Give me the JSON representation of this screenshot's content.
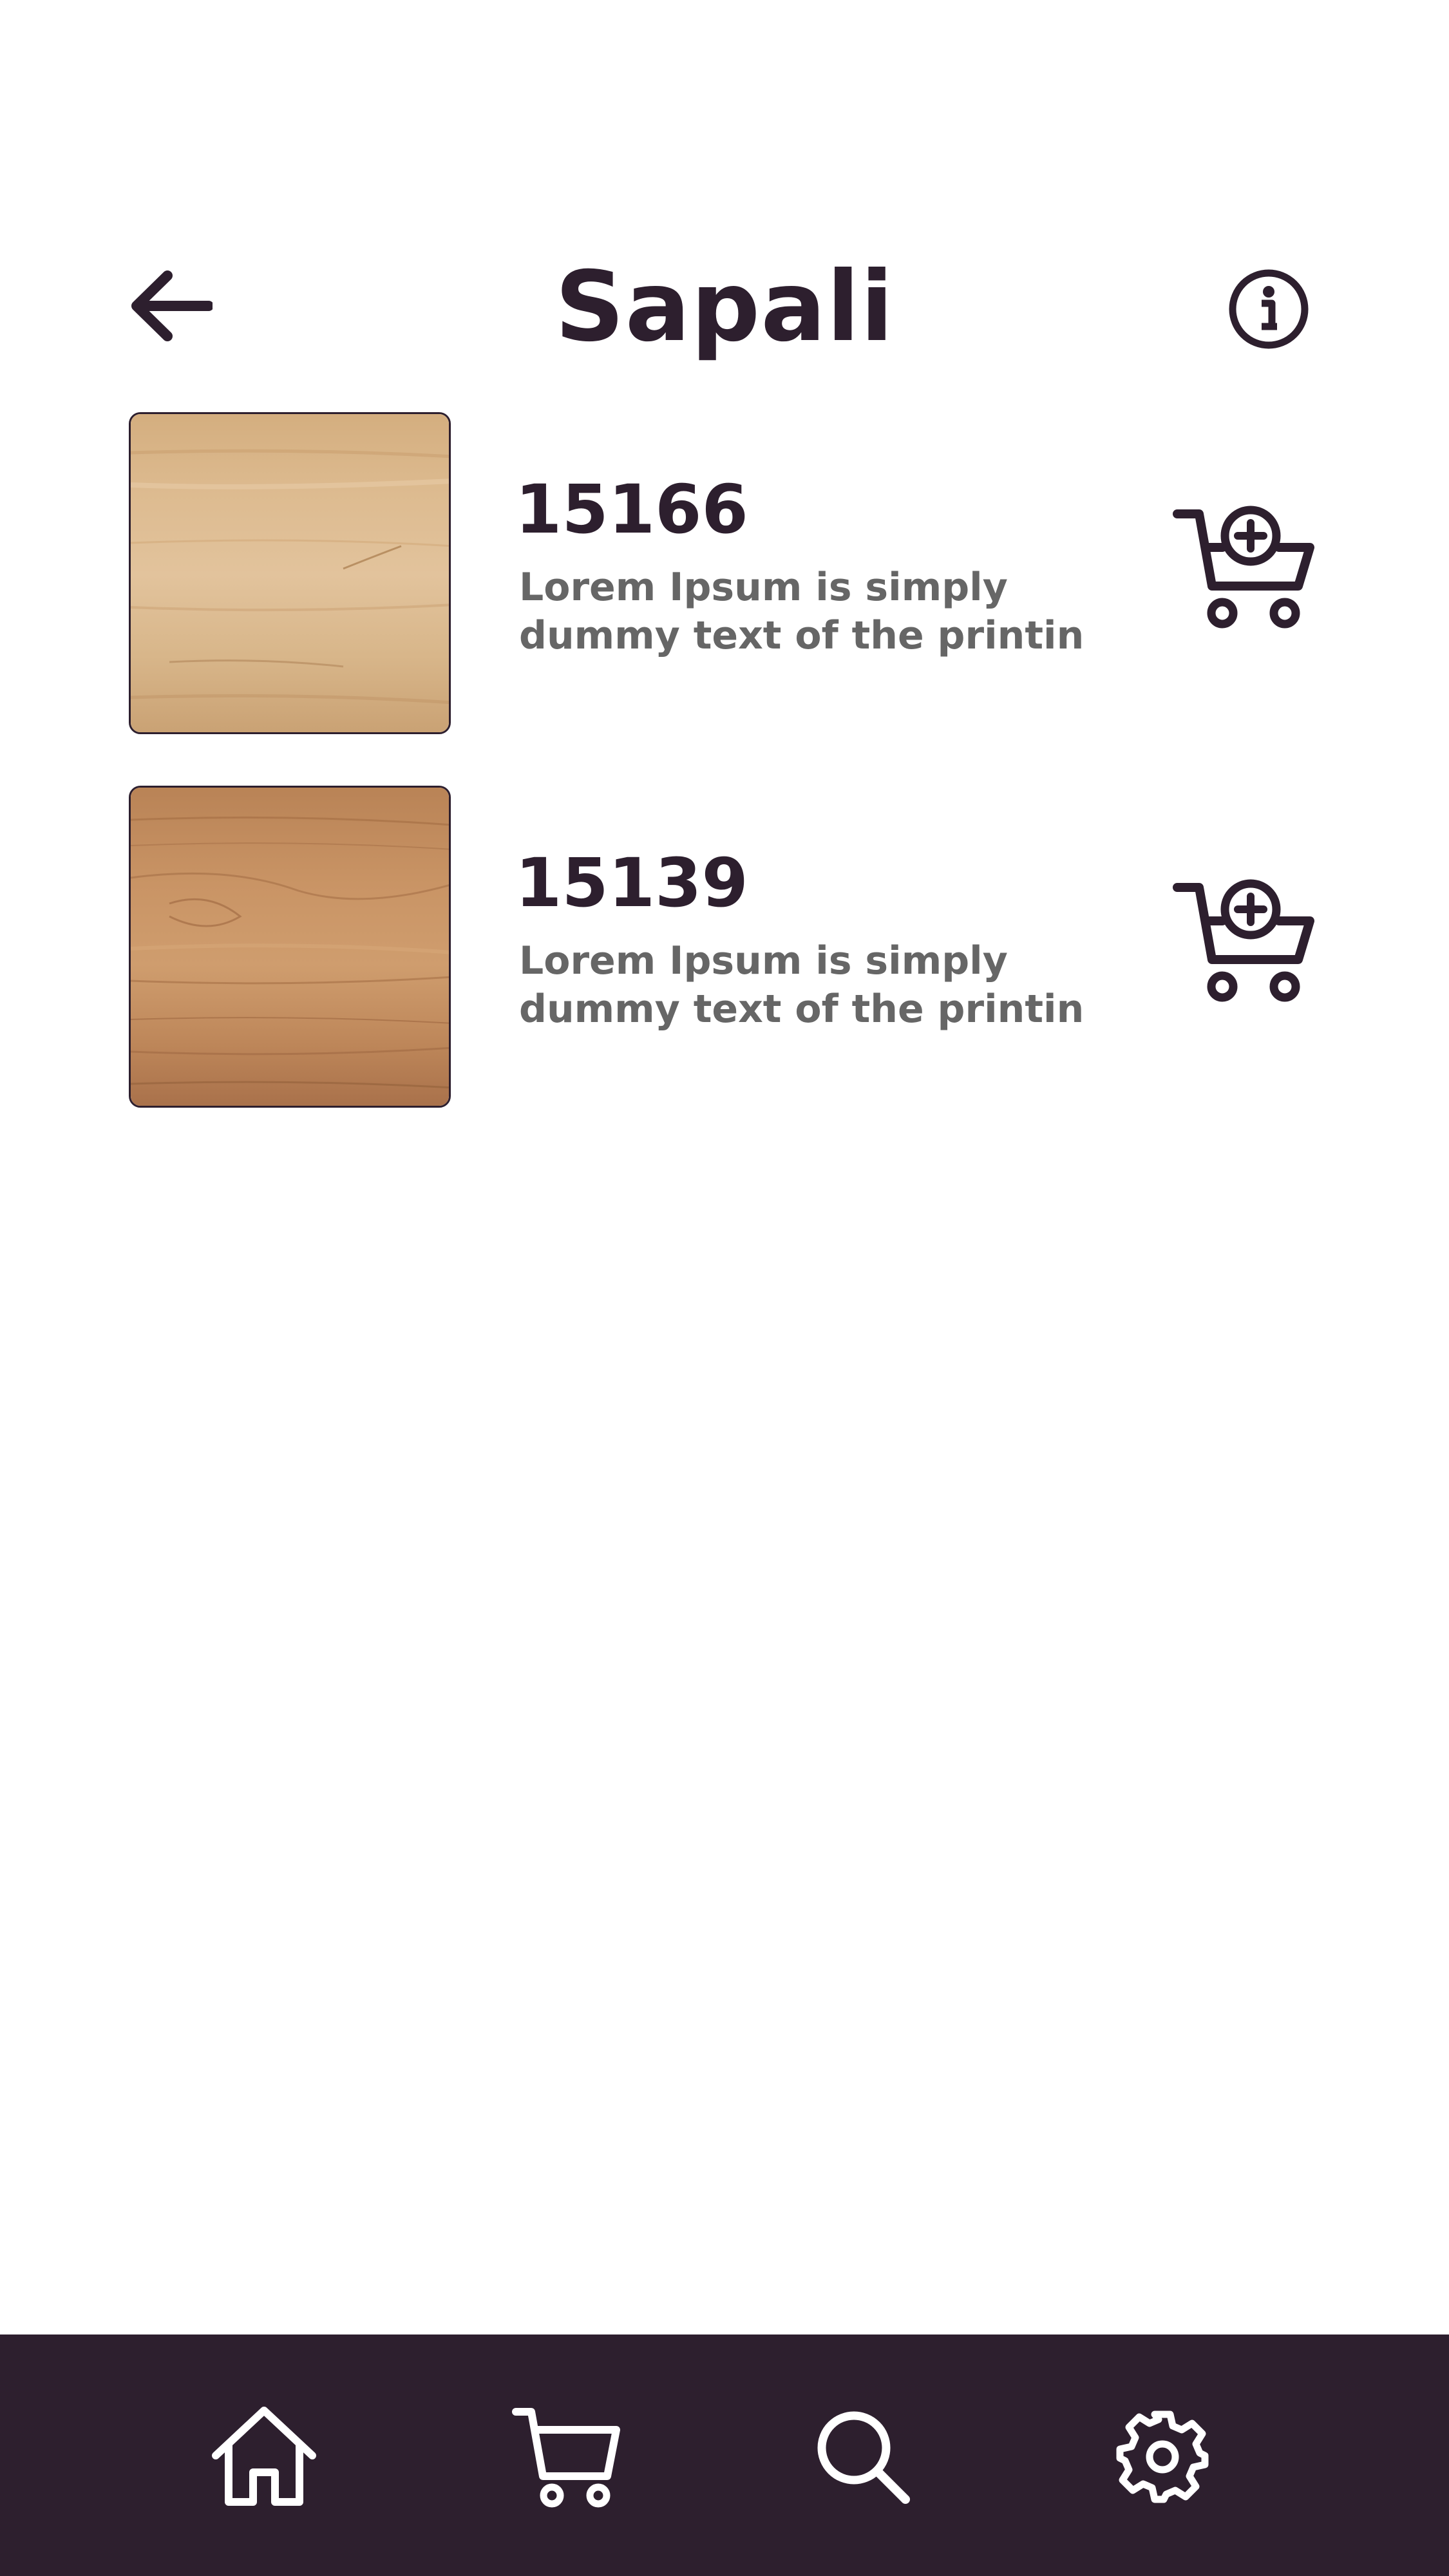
{
  "header": {
    "title": "Sapali",
    "back_icon": "arrow-left-icon",
    "info_icon": "info-icon"
  },
  "products": [
    {
      "code": "15166",
      "line1": "Lorem Ipsum is simply",
      "line2": "dummy text of the printin",
      "swatch": "light-maple-wood",
      "action_icon": "cart-add-icon"
    },
    {
      "code": "15139",
      "line1": "Lorem Ipsum is simply",
      "line2": "dummy text of the printin",
      "swatch": "cherry-wood",
      "action_icon": "cart-add-icon"
    }
  ],
  "bottom_nav": {
    "items": [
      "home-icon",
      "cart-icon",
      "search-icon",
      "settings-icon"
    ]
  },
  "colors": {
    "primary": "#2d1f2e",
    "text_secondary": "#666666",
    "background": "#ffffff"
  }
}
